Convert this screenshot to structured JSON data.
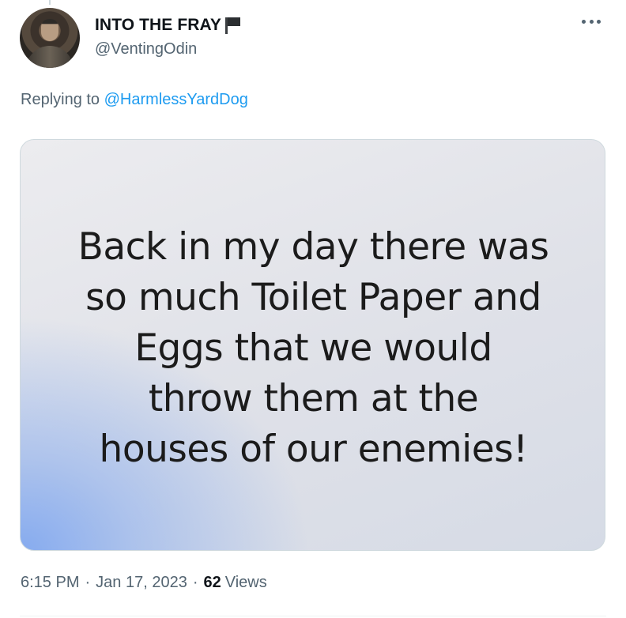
{
  "author": {
    "display_name": "INTO THE FRAY",
    "name_icon": "black-flag-icon",
    "handle": "@VentingOdin"
  },
  "reply_context": {
    "prefix": "Replying to",
    "mention": "@HarmlessYardDog"
  },
  "media": {
    "text_lines": [
      "Back in my day there was",
      "so much Toilet Paper and",
      "Eggs that we would",
      "throw them at the",
      "houses of our enemies!"
    ]
  },
  "meta": {
    "time": "6:15 PM",
    "separator": "·",
    "date": "Jan 17, 2023",
    "views_count": "62",
    "views_label": "Views"
  },
  "colors": {
    "text_primary": "#0f1419",
    "text_secondary": "#536471",
    "link": "#1d9bf0",
    "border": "#cfd9de"
  }
}
